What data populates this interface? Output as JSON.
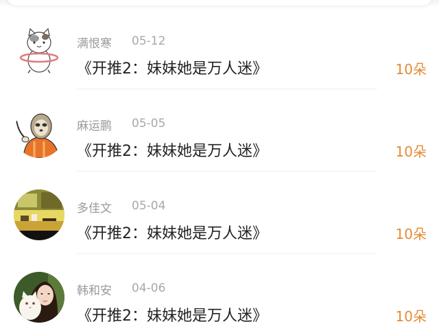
{
  "accent_color": "#e58a35",
  "records": [
    {
      "name": "满恨寒",
      "date": "05-12",
      "title": "《开推2：妹妹她是万人迷》",
      "amount": "10朵",
      "avatar": "cat-hula-hoop-sticker"
    },
    {
      "name": "麻运鹏",
      "date": "05-05",
      "title": "《开推2：妹妹她是万人迷》",
      "amount": "10朵",
      "avatar": "sloth-pointing-sticker"
    },
    {
      "name": "多佳文",
      "date": "05-04",
      "title": "《开推2：妹妹她是万人迷》",
      "amount": "10朵",
      "avatar": "desk-photo"
    },
    {
      "name": "韩和安",
      "date": "04-06",
      "title": "《开推2：妹妹她是万人迷》",
      "amount": "10朵",
      "avatar": "girl-with-cat-photo"
    }
  ]
}
